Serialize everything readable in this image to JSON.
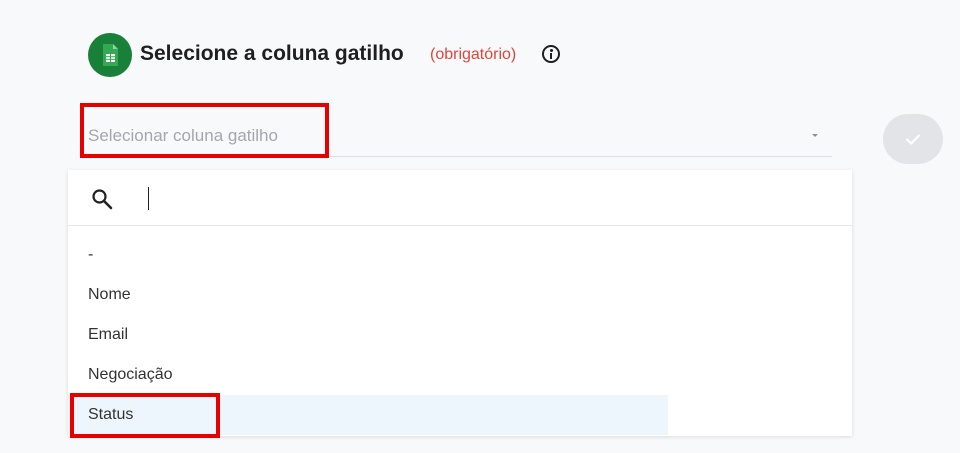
{
  "header": {
    "title": "Selecione a coluna gatilho",
    "required_label": "(obrigatório)"
  },
  "select": {
    "placeholder": "Selecionar coluna gatilho"
  },
  "search": {
    "value": "",
    "placeholder": ""
  },
  "options": [
    "-",
    "Nome",
    "Email",
    "Negociação",
    "Status"
  ],
  "highlighted_option": "Status",
  "colors": {
    "required": "#e0453a",
    "highlight_bg": "#edf6fd",
    "annotation": "#e60000",
    "sheets_green": "#188038"
  }
}
